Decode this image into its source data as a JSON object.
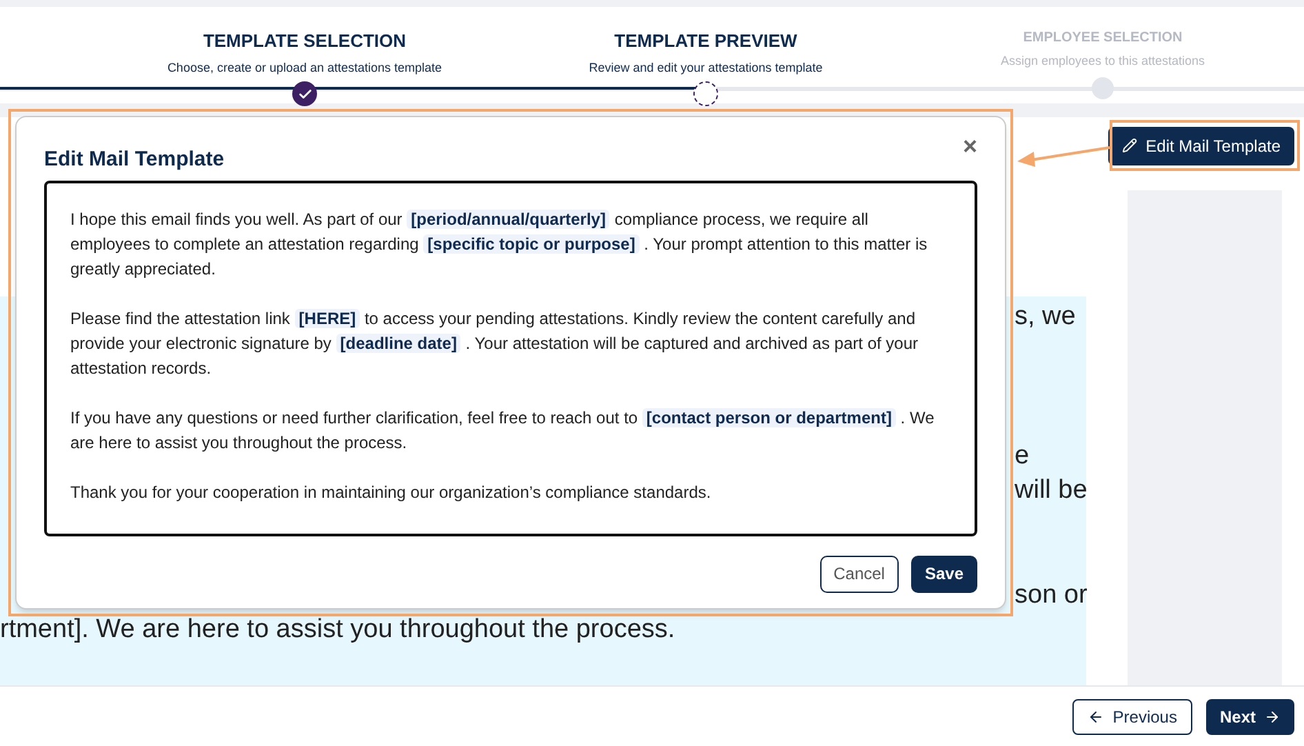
{
  "steps": [
    {
      "title": "TEMPLATE SELECTION",
      "subtitle": "Choose, create or upload an attestations template",
      "kind": "done"
    },
    {
      "title": "TEMPLATE PREVIEW",
      "subtitle": "Review and edit your attestations template",
      "kind": "current"
    },
    {
      "title": "EMPLOYEE SELECTION",
      "subtitle": "Assign employees to this attestations",
      "kind": "upcoming"
    }
  ],
  "edit_button": "Edit Mail Template",
  "background_fragments": [
    {
      "kind": "right",
      "text": "s, we"
    },
    {
      "kind": "gap"
    },
    {
      "kind": "gap"
    },
    {
      "kind": "break"
    },
    {
      "kind": "right",
      "text": "e"
    },
    {
      "kind": "right",
      "text": "will be"
    },
    {
      "kind": "gap"
    },
    {
      "kind": "break"
    },
    {
      "kind": "right",
      "text": "son or"
    },
    {
      "kind": "left",
      "text": "rtment]. We are here to assist you throughout the process."
    }
  ],
  "modal": {
    "title": "Edit Mail Template",
    "close": "×",
    "paragraphs": [
      [
        {
          "kind": "text",
          "text": "I hope this email finds you well. As part of our "
        },
        {
          "kind": "placeholder",
          "text": "[period/annual/quarterly]"
        },
        {
          "kind": "text",
          "text": " compliance process, we require all employees to complete an attestation regarding "
        },
        {
          "kind": "placeholder",
          "text": "[specific topic or purpose]"
        },
        {
          "kind": "text",
          "text": " . Your prompt attention to this matter is greatly appreciated."
        }
      ],
      [
        {
          "kind": "text",
          "text": "Please find the attestation link "
        },
        {
          "kind": "placeholder",
          "text": "[HERE]"
        },
        {
          "kind": "text",
          "text": " to access your pending attestations. Kindly review the content carefully and provide your electronic signature by "
        },
        {
          "kind": "placeholder",
          "text": "[deadline date]"
        },
        {
          "kind": "text",
          "text": " . Your attestation will be captured and archived as part of your attestation records."
        }
      ],
      [
        {
          "kind": "text",
          "text": "If you have any questions or need further clarification, feel free to reach out to "
        },
        {
          "kind": "placeholder",
          "text": "[contact person or department]"
        },
        {
          "kind": "text",
          "text": " . We are here to assist you throughout the process."
        }
      ],
      [
        {
          "kind": "text",
          "text": "Thank you for your cooperation in maintaining our organization’s compliance standards."
        }
      ]
    ],
    "buttons": [
      "Cancel",
      "Save"
    ]
  },
  "footer": {
    "previous": "Previous",
    "next": "Next"
  }
}
